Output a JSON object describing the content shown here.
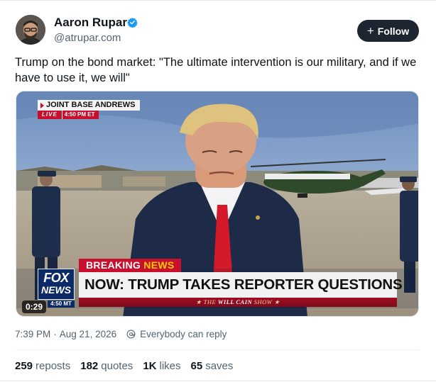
{
  "author": {
    "name": "Aaron Rupar",
    "handle": "@atrupar.com",
    "verified": true,
    "verified_color": "#1d9bf0"
  },
  "follow": {
    "plus": "+",
    "label": "Follow"
  },
  "post": {
    "text": "Trump on the bond market: \"The ultimate intervention is our military, and if we have to use it, we will\""
  },
  "video": {
    "location": "JOINT BASE ANDREWS",
    "live_label": "LIVE",
    "live_time": "4:50 PM ET",
    "breaking_prefix": "BREAKING",
    "breaking_suffix": "NEWS",
    "headline": "NOW: TRUMP TAKES REPORTER QUESTIONS",
    "show_prefix": "★ THE",
    "show_name": "WILL CAIN",
    "show_suffix": "SHOW ★",
    "network_line1": "FOX",
    "network_line2": "NEWS",
    "network_clock": "4:50 MT",
    "duration": "0:29",
    "accent_red": "#c8102e",
    "accent_navy": "#0b2a66"
  },
  "meta": {
    "time": "7:39 PM",
    "separator": "·",
    "date": "Aug 21, 2026",
    "reply_setting": "Everybody can reply",
    "reply_icon": "at-circle-icon"
  },
  "stats": {
    "reposts": {
      "count": "259",
      "label": "reposts"
    },
    "quotes": {
      "count": "182",
      "label": "quotes"
    },
    "likes": {
      "count": "1K",
      "label": "likes"
    },
    "saves": {
      "count": "65",
      "label": "saves"
    }
  }
}
